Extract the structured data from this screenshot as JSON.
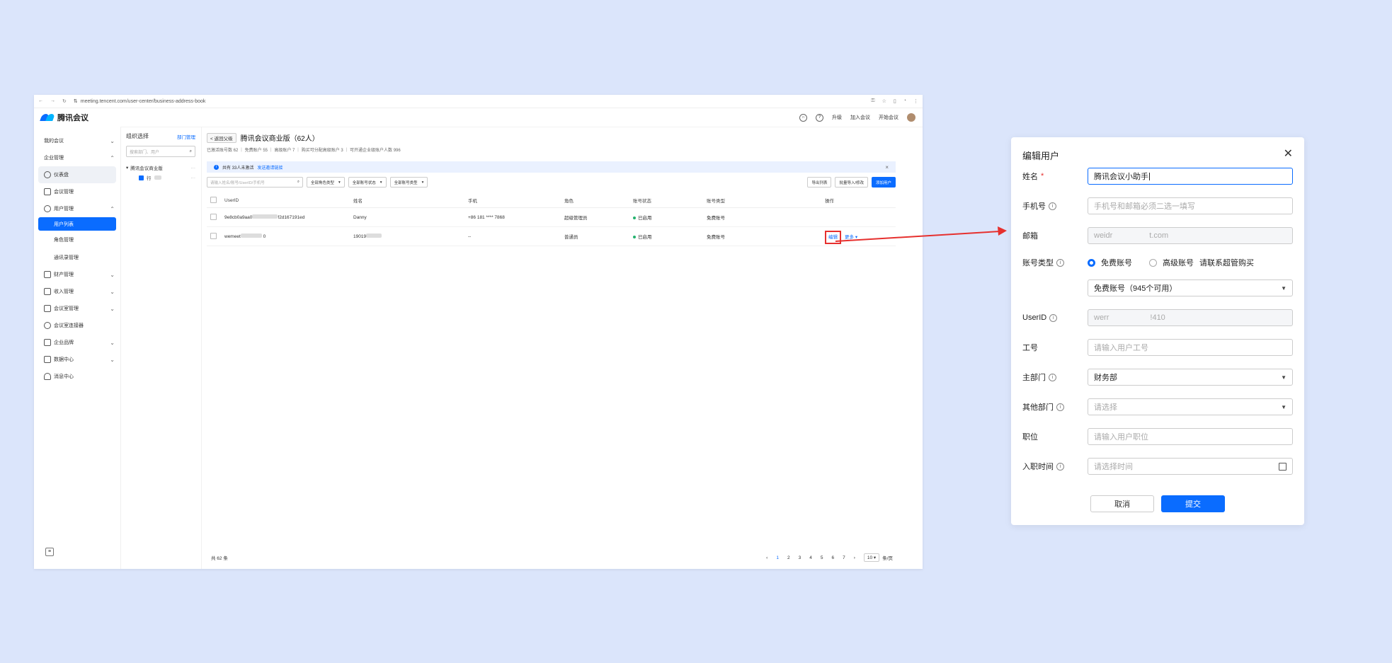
{
  "browser": {
    "url": "meeting.tencent.com/user-center/business-address-book"
  },
  "header": {
    "brand": "腾讯会议",
    "upgrade": "升级",
    "join_meeting": "加入会议",
    "start_meeting": "开始会议"
  },
  "sidebar": {
    "items": [
      {
        "label": "我的会议"
      },
      {
        "label": "企业管理"
      },
      {
        "label": "仪表盘"
      },
      {
        "label": "会议管理"
      },
      {
        "label": "用户管理"
      },
      {
        "label": "用户列表"
      },
      {
        "label": "角色管理"
      },
      {
        "label": "通讯录管理"
      },
      {
        "label": "财产管理"
      },
      {
        "label": "收入管理"
      },
      {
        "label": "会议室管理"
      },
      {
        "label": "会议室连接器"
      },
      {
        "label": "企业品牌"
      },
      {
        "label": "数据中心"
      },
      {
        "label": "消息中心"
      }
    ]
  },
  "org": {
    "title": "组织选择",
    "manage_link": "部门管理",
    "search_placeholder": "搜索部门、用户",
    "root": "腾讯会议商业版",
    "child": "行"
  },
  "main": {
    "back": "< 返回父级",
    "title": "腾讯会议商业版（62人）",
    "stats": "已激活账号数 62 ｜ 免费账户 55 ｜ 高级账户 7 ｜ 购买可分配高级账户 3 ｜ 可开通企业级账户人数 996",
    "notice": "共有 33人未激活",
    "notice_link": "发送邀请链接",
    "filters": {
      "search_placeholder": "请输入姓名/账号/UserID/手机号",
      "role": "全部角色类型",
      "status": "全部账号状态",
      "type": "全部账号类型",
      "export": "导出列表",
      "batch": "批量导入/修改",
      "add": "添加用户"
    },
    "table": {
      "headers": [
        "UserID",
        "姓名",
        "手机",
        "角色",
        "账号状态",
        "账号类型",
        "操作"
      ],
      "rows": [
        {
          "userid": "9e8cb0a9aa0",
          "userid_tail": "f2d167191ed",
          "name": "Danny",
          "phone": "+86 181 **** 7868",
          "role": "超级管理员",
          "status": "已启用",
          "type": "免费账号",
          "edit": "",
          "more": ""
        },
        {
          "userid": "wemeet",
          "userid_tail": "0",
          "name": "19019",
          "phone": "--",
          "role": "普通员",
          "status": "已启用",
          "type": "免费账号",
          "edit": "编辑",
          "more": "更多"
        }
      ]
    },
    "total": "共 62 条",
    "pager": {
      "pages": [
        "1",
        "2",
        "3",
        "4",
        "5",
        "6",
        "7"
      ],
      "size": "10",
      "size_suffix": "条/页"
    }
  },
  "dialog": {
    "title": "编辑用户",
    "fields": {
      "name_label": "姓名",
      "name_value": "腾讯会议小助手",
      "phone_label": "手机号",
      "phone_placeholder": "手机号和邮箱必须二选一填写",
      "email_label": "邮箱",
      "email_value": "weidr",
      "email_tail": "t.com",
      "acct_type_label": "账号类型",
      "free_option": "免费账号",
      "premium_option": "高级账号",
      "contact_text": "请联系超管购买",
      "acct_select": "免费账号（945个可用）",
      "userid_label": "UserID",
      "userid_value": "werr",
      "userid_tail": "!410",
      "empno_label": "工号",
      "empno_placeholder": "请输入用户工号",
      "dept_label": "主部门",
      "dept_value": "财务部",
      "other_dept_label": "其他部门",
      "other_dept_placeholder": "请选择",
      "position_label": "职位",
      "position_placeholder": "请输入用户职位",
      "join_label": "入职时间",
      "join_placeholder": "请选择时间"
    },
    "cancel": "取消",
    "submit": "提交"
  },
  "colors": {
    "primary": "#0a6cff",
    "highlight": "#e6302e",
    "background": "#dbe5fb"
  }
}
